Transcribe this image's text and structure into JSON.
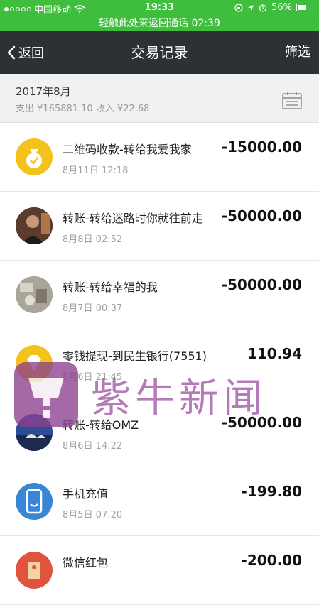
{
  "status_bar": {
    "carrier": "中国移动",
    "time": "19:33",
    "battery": "56%",
    "battery_level": 0.56
  },
  "call_banner": "轻触此处来返回通话 02:39",
  "nav": {
    "back_label": "返回",
    "title": "交易记录",
    "filter_label": "筛选"
  },
  "month": {
    "label": "2017年8月",
    "summary": "支出 ¥165881.10 收入 ¥22.68"
  },
  "transactions": [
    {
      "title": "二维码收款-转给我爱我家",
      "time": "8月11日 12:18",
      "amount": "-15000.00",
      "icon": "money-bag-icon"
    },
    {
      "title": "转账-转给迷路时你就往前走",
      "time": "8月8日 02:52",
      "amount": "-50000.00",
      "icon": "avatar"
    },
    {
      "title": "转账-转给幸福的我",
      "time": "8月7日 00:37",
      "amount": "-50000.00",
      "icon": "avatar"
    },
    {
      "title": "零钱提现-到民生银行(7551)",
      "time": "8月6日 21:45",
      "amount": "110.94",
      "icon": "diamond-icon"
    },
    {
      "title": "转账-转给OMZ",
      "time": "8月6日 14:22",
      "amount": "-50000.00",
      "icon": "avatar"
    },
    {
      "title": "手机充值",
      "time": "8月5日 07:20",
      "amount": "-199.80",
      "icon": "phone-icon"
    },
    {
      "title": "微信红包",
      "time": "",
      "amount": "-200.00",
      "icon": "red-packet-icon"
    }
  ],
  "watermark": {
    "text": "紫牛新闻"
  },
  "colors": {
    "status_green": "#3fbd3d",
    "nav_dark": "#2e3133",
    "icon_yellow": "#f4c21c",
    "phone_blue": "#3a86d6",
    "red_packet": "#e0533d",
    "watermark_purple": "#a055a6"
  }
}
